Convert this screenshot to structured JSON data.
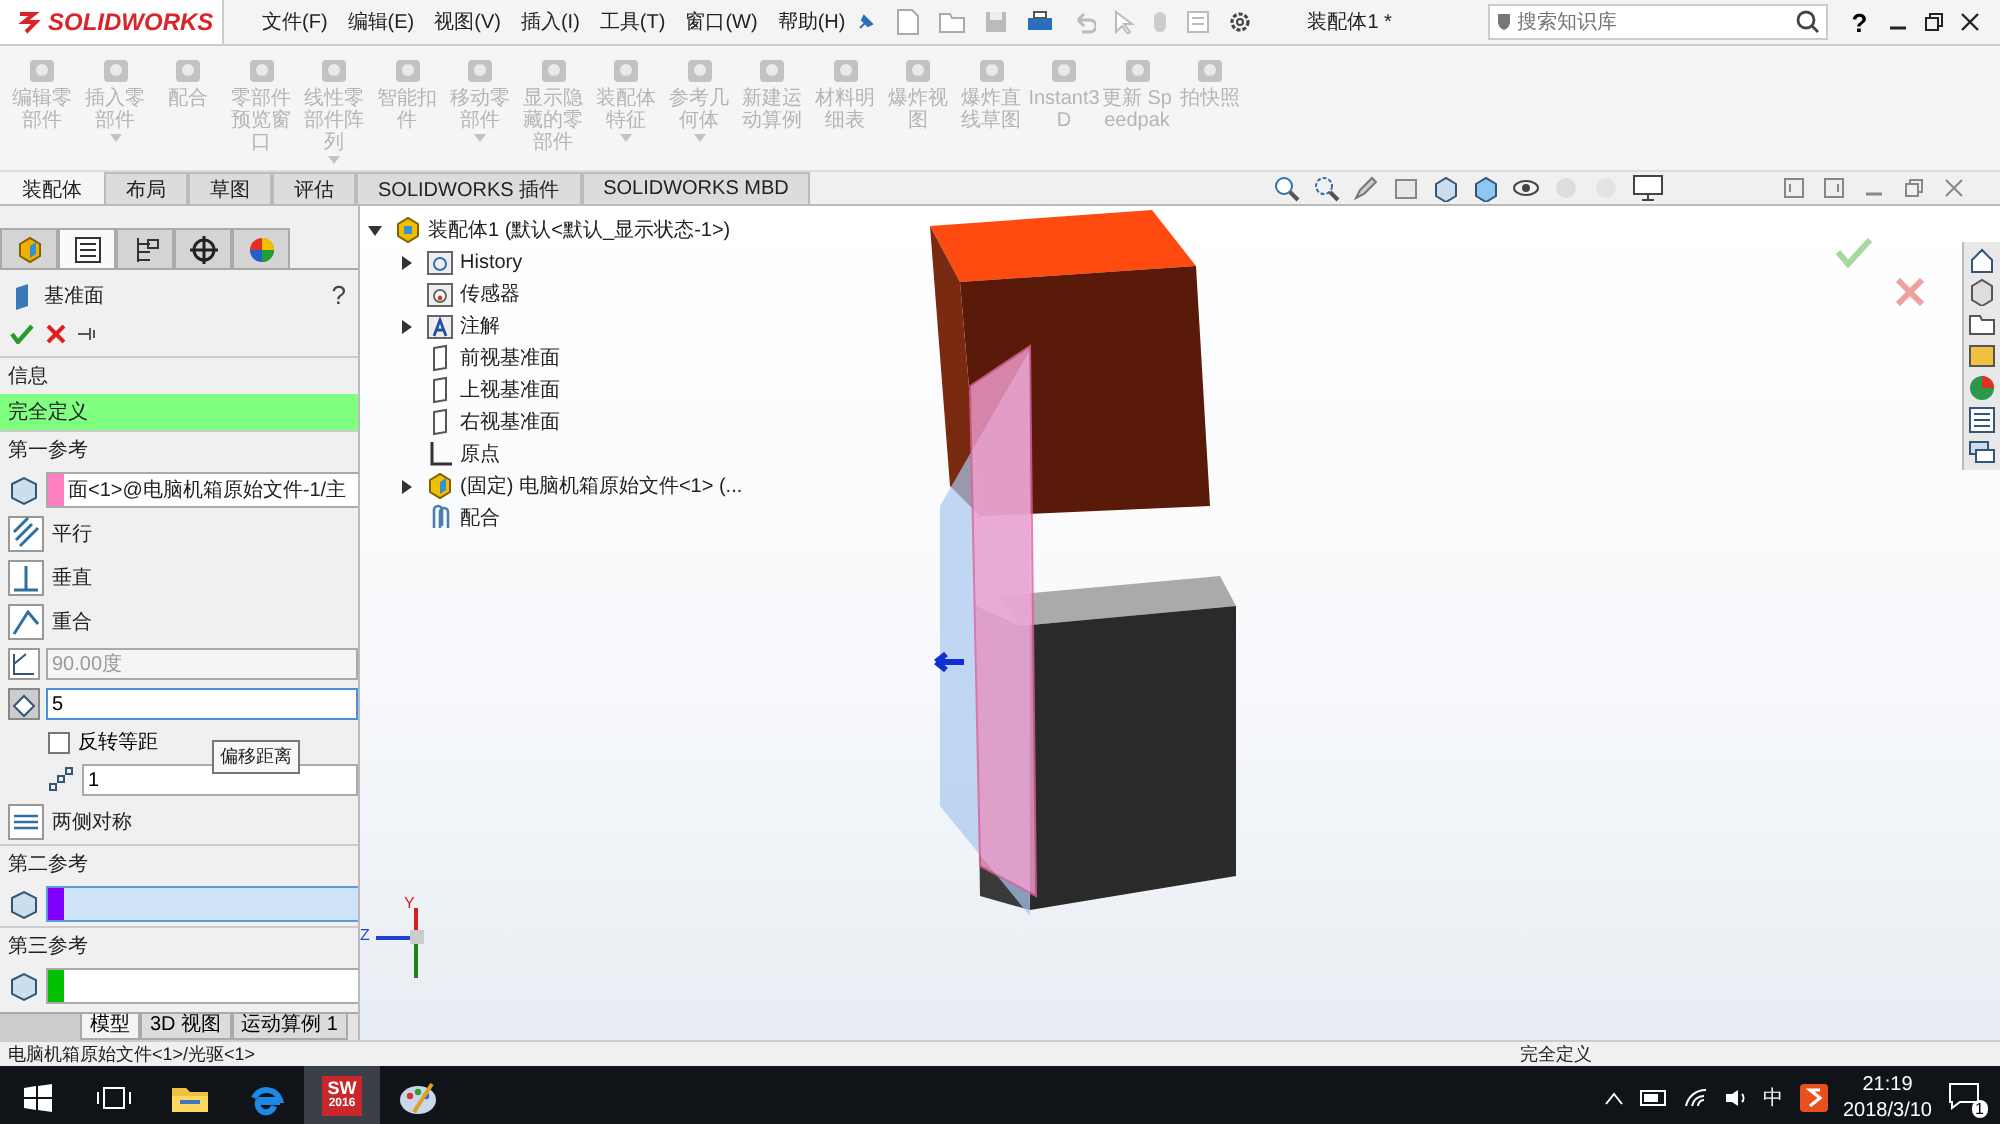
{
  "app": {
    "logo": "SOLIDWORKS",
    "menu": [
      "文件(F)",
      "编辑(E)",
      "视图(V)",
      "插入(I)",
      "工具(T)",
      "窗口(W)",
      "帮助(H)"
    ],
    "document_title": "装配体1 *",
    "search": {
      "placeholder": "搜索知识库"
    },
    "help": "?"
  },
  "ribbon": {
    "buttons": [
      {
        "label": "编辑零部件",
        "disabled": true,
        "dropdown": false
      },
      {
        "label": "插入零部件",
        "disabled": true,
        "dropdown": true
      },
      {
        "label": "配合",
        "disabled": true,
        "dropdown": false
      },
      {
        "label": "零部件预览窗口",
        "disabled": true,
        "dropdown": false
      },
      {
        "label": "线性零部件阵列",
        "disabled": true,
        "dropdown": true
      },
      {
        "label": "智能扣件",
        "disabled": true,
        "dropdown": false
      },
      {
        "label": "移动零部件",
        "disabled": true,
        "dropdown": true
      },
      {
        "label": "显示隐藏的零部件",
        "disabled": true,
        "dropdown": false
      },
      {
        "label": "装配体特征",
        "disabled": true,
        "dropdown": true
      },
      {
        "label": "参考几何体",
        "disabled": true,
        "dropdown": true
      },
      {
        "label": "新建运动算例",
        "disabled": true,
        "dropdown": false
      },
      {
        "label": "材料明细表",
        "disabled": true,
        "dropdown": false
      },
      {
        "label": "爆炸视图",
        "disabled": true,
        "dropdown": false
      },
      {
        "label": "爆炸直线草图",
        "disabled": true,
        "dropdown": false
      },
      {
        "label": "Instant3D",
        "disabled": true,
        "dropdown": false
      },
      {
        "label": "更新 Speedpak",
        "disabled": true,
        "dropdown": false
      },
      {
        "label": "拍快照",
        "disabled": true,
        "dropdown": false
      }
    ]
  },
  "command_tabs": [
    {
      "label": "装配体",
      "selected": true
    },
    {
      "label": "布局",
      "selected": false
    },
    {
      "label": "草图",
      "selected": false
    },
    {
      "label": "评估",
      "selected": false
    },
    {
      "label": "SOLIDWORKS 插件",
      "selected": false
    },
    {
      "label": "SOLIDWORKS MBD",
      "selected": false
    }
  ],
  "property_manager": {
    "tabs": [
      {
        "kind": "feature",
        "selected": false
      },
      {
        "kind": "property",
        "selected": true
      },
      {
        "kind": "config",
        "selected": false
      },
      {
        "kind": "dimxpert",
        "selected": false
      },
      {
        "kind": "display",
        "selected": false
      }
    ],
    "title": "基准面",
    "help": "?",
    "info": {
      "title": "信息",
      "message": "完全定义"
    },
    "first_reference": {
      "title": "第一参考",
      "field": {
        "value": "面<1>@电脑机箱原始文件-1/主",
        "color": "#ff80c0",
        "selected": false
      },
      "options": [
        {
          "kind": "parallel",
          "label": "平行"
        },
        {
          "kind": "perpendicular",
          "label": "垂直"
        },
        {
          "kind": "coincident",
          "label": "重合"
        }
      ],
      "angle": {
        "value": "90.00度",
        "disabled": true
      },
      "distance": {
        "value": "5",
        "selected": true
      },
      "flip": {
        "label": "反转等距",
        "checked": false
      },
      "count": {
        "value": "1"
      },
      "symmetric": {
        "label": "两侧对称"
      }
    },
    "tooltip": "偏移距离",
    "second_reference": {
      "title": "第二参考",
      "field": {
        "color": "#8000ff",
        "selected": true
      }
    },
    "third_reference": {
      "title": "第三参考",
      "field": {
        "color": "#00c000",
        "selected": false
      }
    }
  },
  "tree": {
    "items": [
      {
        "label": "装配体1  (默认<默认_显示状态-1>)",
        "kind": "assembly",
        "expanded": true,
        "children": [
          {
            "label": "History",
            "kind": "history",
            "expanded": false
          },
          {
            "label": "传感器",
            "kind": "sensor"
          },
          {
            "label": "注解",
            "kind": "annotation",
            "expanded": false
          },
          {
            "label": "前视基准面",
            "kind": "plane"
          },
          {
            "label": "上视基准面",
            "kind": "plane"
          },
          {
            "label": "右视基准面",
            "kind": "plane"
          },
          {
            "label": "原点",
            "kind": "origin"
          },
          {
            "label": "(固定) 电脑机箱原始文件<1> (...",
            "kind": "part",
            "expanded": false
          },
          {
            "label": "配合",
            "kind": "mates"
          }
        ]
      }
    ]
  },
  "triad": {
    "labels": [
      "Y",
      "Z"
    ]
  },
  "bottom_tabs": [
    {
      "label": "模型",
      "selected": true
    },
    {
      "label": "3D 视图",
      "selected": false
    },
    {
      "label": "运动算例 1",
      "selected": false
    }
  ],
  "status_bar": {
    "message": "电脑机箱原始文件<1>/光驱<1>",
    "state": "完全定义"
  },
  "taskbar": {
    "apps": [
      {
        "kind": "task-view",
        "selected": false
      },
      {
        "kind": "folder",
        "selected": false
      },
      {
        "kind": "edge",
        "selected": false
      },
      {
        "kind": "solidworks",
        "selected": true,
        "icon_text": "SW",
        "badge": "2016"
      },
      {
        "kind": "paint",
        "selected": false
      }
    ],
    "ime": "中",
    "time": "21:19",
    "date": "2018/3/10",
    "notifications": "1"
  }
}
